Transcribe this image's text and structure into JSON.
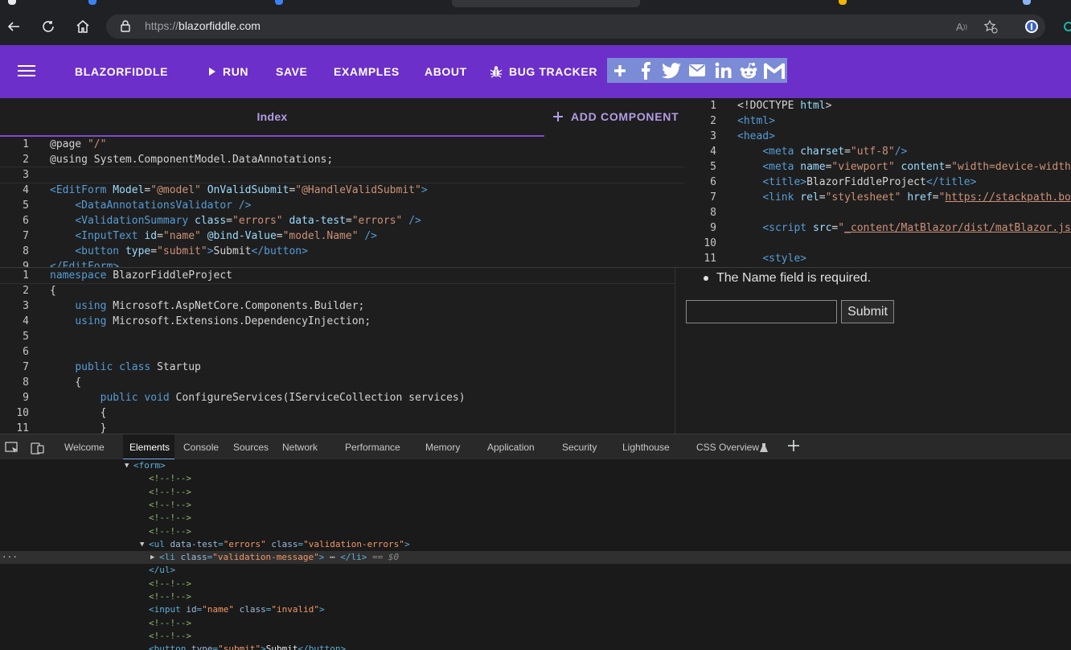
{
  "browser": {
    "url_protocol": "https://",
    "url_host": "blazorfiddle.com"
  },
  "appbar": {
    "brand": "BLAZORFIDDLE",
    "run": "RUN",
    "save": "SAVE",
    "examples": "EXAMPLES",
    "about": "ABOUT",
    "bug_tracker": "BUG TRACKER"
  },
  "editor_tabs": {
    "index_tab": "Index",
    "add_component": "ADD COMPONENT"
  },
  "razor_lines": [
    {
      "n": "1",
      "parts": [
        [
          "t-plain",
          "@page "
        ],
        [
          "t-str",
          "\"/\""
        ]
      ]
    },
    {
      "n": "2",
      "parts": [
        [
          "t-plain",
          "@using System.ComponentModel.DataAnnotations;"
        ]
      ]
    },
    {
      "n": "3",
      "parts": []
    },
    {
      "n": "4",
      "parts": [
        [
          "t-tag",
          "<EditForm "
        ],
        [
          "t-attr",
          "Model"
        ],
        [
          "t-plain",
          "="
        ],
        [
          "t-str",
          "\"@model\" "
        ],
        [
          "t-attr",
          "OnValidSubmit"
        ],
        [
          "t-plain",
          "="
        ],
        [
          "t-str",
          "\"@HandleValidSubmit\""
        ],
        [
          "t-tag",
          ">"
        ]
      ]
    },
    {
      "n": "5",
      "parts": [
        [
          "t-plain",
          "    "
        ],
        [
          "t-tag",
          "<DataAnnotationsValidator />"
        ]
      ]
    },
    {
      "n": "6",
      "parts": [
        [
          "t-plain",
          "    "
        ],
        [
          "t-tag",
          "<ValidationSummary "
        ],
        [
          "t-attr",
          "class"
        ],
        [
          "t-plain",
          "="
        ],
        [
          "t-str",
          "\"errors\" "
        ],
        [
          "t-attr",
          "data-test"
        ],
        [
          "t-plain",
          "="
        ],
        [
          "t-str",
          "\"errors\" "
        ],
        [
          "t-tag",
          "/>"
        ]
      ]
    },
    {
      "n": "7",
      "parts": [
        [
          "t-plain",
          "    "
        ],
        [
          "t-tag",
          "<InputText "
        ],
        [
          "t-attr",
          "id"
        ],
        [
          "t-plain",
          "="
        ],
        [
          "t-str",
          "\"name\" "
        ],
        [
          "t-attr",
          "@bind-Value"
        ],
        [
          "t-plain",
          "="
        ],
        [
          "t-str",
          "\"model.Name\" "
        ],
        [
          "t-tag",
          "/>"
        ]
      ]
    },
    {
      "n": "8",
      "parts": [
        [
          "t-plain",
          "    "
        ],
        [
          "t-tag",
          "<button "
        ],
        [
          "t-attr",
          "type"
        ],
        [
          "t-plain",
          "="
        ],
        [
          "t-str",
          "\"submit\""
        ],
        [
          "t-tag",
          ">"
        ],
        [
          "t-plain",
          "Submit"
        ],
        [
          "t-tag",
          "</button>"
        ]
      ]
    },
    {
      "n": "9",
      "parts": [
        [
          "t-tag",
          "</EditForm>"
        ]
      ]
    }
  ],
  "startup_lines": [
    {
      "n": "1",
      "parts": [
        [
          "t-kw",
          "namespace "
        ],
        [
          "t-plain",
          "BlazorFiddleProject"
        ]
      ]
    },
    {
      "n": "2",
      "parts": [
        [
          "t-plain",
          "{"
        ]
      ]
    },
    {
      "n": "3",
      "parts": [
        [
          "t-plain",
          "    "
        ],
        [
          "t-kw",
          "using "
        ],
        [
          "t-plain",
          "Microsoft.AspNetCore.Components.Builder;"
        ]
      ]
    },
    {
      "n": "4",
      "parts": [
        [
          "t-plain",
          "    "
        ],
        [
          "t-kw",
          "using "
        ],
        [
          "t-plain",
          "Microsoft.Extensions.DependencyInjection;"
        ]
      ]
    },
    {
      "n": "5",
      "parts": []
    },
    {
      "n": "6",
      "parts": []
    },
    {
      "n": "7",
      "parts": [
        [
          "t-plain",
          "    "
        ],
        [
          "t-kw",
          "public class "
        ],
        [
          "t-plain",
          "Startup"
        ]
      ]
    },
    {
      "n": "8",
      "parts": [
        [
          "t-plain",
          "    {"
        ]
      ]
    },
    {
      "n": "9",
      "parts": [
        [
          "t-plain",
          "        "
        ],
        [
          "t-kw",
          "public void "
        ],
        [
          "t-plain",
          "ConfigureServices(IServiceCollection services)"
        ]
      ]
    },
    {
      "n": "10",
      "parts": [
        [
          "t-plain",
          "        {"
        ]
      ]
    },
    {
      "n": "11",
      "parts": [
        [
          "t-plain",
          "        }"
        ]
      ]
    }
  ],
  "html_lines": [
    {
      "n": "1",
      "parts": [
        [
          "t-plain",
          "<!DOCTYPE "
        ],
        [
          "t-attr",
          "html"
        ],
        [
          "t-plain",
          ">"
        ]
      ]
    },
    {
      "n": "2",
      "parts": [
        [
          "t-tag",
          "<html>"
        ]
      ]
    },
    {
      "n": "3",
      "parts": [
        [
          "t-tag",
          "<head>"
        ]
      ]
    },
    {
      "n": "4",
      "parts": [
        [
          "t-plain",
          "    "
        ],
        [
          "t-tag",
          "<meta "
        ],
        [
          "t-attr",
          "charset"
        ],
        [
          "t-plain",
          "="
        ],
        [
          "t-str",
          "\"utf-8\""
        ],
        [
          "t-tag",
          "/>"
        ]
      ]
    },
    {
      "n": "5",
      "parts": [
        [
          "t-plain",
          "    "
        ],
        [
          "t-tag",
          "<meta "
        ],
        [
          "t-attr",
          "name"
        ],
        [
          "t-plain",
          "="
        ],
        [
          "t-str",
          "\"viewport\" "
        ],
        [
          "t-attr",
          "content"
        ],
        [
          "t-plain",
          "="
        ],
        [
          "t-str",
          "\"width=device-width\""
        ]
      ]
    },
    {
      "n": "6",
      "parts": [
        [
          "t-plain",
          "    "
        ],
        [
          "t-tag",
          "<title>"
        ],
        [
          "t-plain",
          "BlazorFiddleProject"
        ],
        [
          "t-tag",
          "</title>"
        ]
      ]
    },
    {
      "n": "7",
      "parts": [
        [
          "t-plain",
          "    "
        ],
        [
          "t-tag",
          "<link "
        ],
        [
          "t-attr",
          "rel"
        ],
        [
          "t-plain",
          "="
        ],
        [
          "t-str",
          "\"stylesheet\" "
        ],
        [
          "t-attr",
          "href"
        ],
        [
          "t-plain",
          "="
        ],
        [
          "t-str",
          "\""
        ],
        [
          "t-link",
          "https://stackpath.boo"
        ]
      ]
    },
    {
      "n": "8",
      "parts": []
    },
    {
      "n": "9",
      "parts": [
        [
          "t-plain",
          "    "
        ],
        [
          "t-tag",
          "<script "
        ],
        [
          "t-attr",
          "src"
        ],
        [
          "t-plain",
          "="
        ],
        [
          "t-str",
          "\""
        ],
        [
          "t-link",
          "_content/MatBlazor/dist/matBlazor.js"
        ],
        [
          "t-str",
          "\""
        ]
      ]
    },
    {
      "n": "10",
      "parts": []
    },
    {
      "n": "11",
      "parts": [
        [
          "t-plain",
          "    "
        ],
        [
          "t-tag",
          "<style>"
        ]
      ]
    }
  ],
  "preview": {
    "validation_message": "The Name field is required.",
    "input_value": "",
    "submit_label": "Submit"
  },
  "devtools": {
    "tabs": [
      "Welcome",
      "Elements",
      "Console",
      "Sources",
      "Network",
      "Performance",
      "Memory",
      "Application",
      "Security",
      "Lighthouse",
      "CSS Overview"
    ],
    "active_tab": "Elements",
    "dom_lines": [
      {
        "indent": 166,
        "arrow": "open",
        "parts": [
          [
            "e-tag",
            "<form>"
          ]
        ]
      },
      {
        "indent": 185,
        "parts": [
          [
            "e-cmt",
            "<!--!-->"
          ]
        ]
      },
      {
        "indent": 185,
        "parts": [
          [
            "e-cmt",
            "<!--!-->"
          ]
        ]
      },
      {
        "indent": 185,
        "parts": [
          [
            "e-cmt",
            "<!--!-->"
          ]
        ]
      },
      {
        "indent": 185,
        "parts": [
          [
            "e-cmt",
            "<!--!-->"
          ]
        ]
      },
      {
        "indent": 185,
        "parts": [
          [
            "e-cmt",
            "<!--!-->"
          ]
        ]
      },
      {
        "indent": 185,
        "arrow": "open",
        "parts": [
          [
            "e-tag",
            "<ul "
          ],
          [
            "e-attr",
            "data-test"
          ],
          [
            "e-tag",
            "="
          ],
          [
            "e-val",
            "\"errors\" "
          ],
          [
            "e-attr",
            "class"
          ],
          [
            "e-tag",
            "="
          ],
          [
            "e-val",
            "\"validation-errors\""
          ],
          [
            "e-tag",
            ">"
          ]
        ]
      },
      {
        "indent": 198,
        "arrow": "closed",
        "selected": true,
        "parts": [
          [
            "e-tag",
            "<li "
          ],
          [
            "e-attr",
            "class"
          ],
          [
            "e-tag",
            "="
          ],
          [
            "e-val",
            "\"validation-message\""
          ],
          [
            "e-tag",
            ">"
          ],
          [
            "e-txt",
            " ⋯ "
          ],
          [
            "e-tag",
            "</li>"
          ],
          [
            "e-dim",
            " == $0"
          ]
        ]
      },
      {
        "indent": 185,
        "parts": [
          [
            "e-tag",
            "</ul>"
          ]
        ]
      },
      {
        "indent": 185,
        "parts": [
          [
            "e-cmt",
            "<!--!-->"
          ]
        ]
      },
      {
        "indent": 185,
        "parts": [
          [
            "e-cmt",
            "<!--!-->"
          ]
        ]
      },
      {
        "indent": 185,
        "parts": [
          [
            "e-tag",
            "<input "
          ],
          [
            "e-attr",
            "id"
          ],
          [
            "e-tag",
            "="
          ],
          [
            "e-val",
            "\"name\" "
          ],
          [
            "e-attr",
            "class"
          ],
          [
            "e-tag",
            "="
          ],
          [
            "e-val",
            "\"invalid\""
          ],
          [
            "e-tag",
            ">"
          ]
        ]
      },
      {
        "indent": 185,
        "parts": [
          [
            "e-cmt",
            "<!--!-->"
          ]
        ]
      },
      {
        "indent": 185,
        "parts": [
          [
            "e-cmt",
            "<!--!-->"
          ]
        ]
      },
      {
        "indent": 185,
        "parts": [
          [
            "e-tag",
            "<button "
          ],
          [
            "e-attr",
            "type"
          ],
          [
            "e-tag",
            "="
          ],
          [
            "e-val",
            "\"submit\""
          ],
          [
            "e-tag",
            ">"
          ],
          [
            "e-txt",
            "Submit"
          ],
          [
            "e-tag",
            "</button>"
          ]
        ]
      }
    ]
  },
  "colors": {
    "appbar": "#6c2fc9",
    "share_bar": "#7b8bd6",
    "editor_bg": "#1e1e1e",
    "accent": "#b49ce6"
  }
}
